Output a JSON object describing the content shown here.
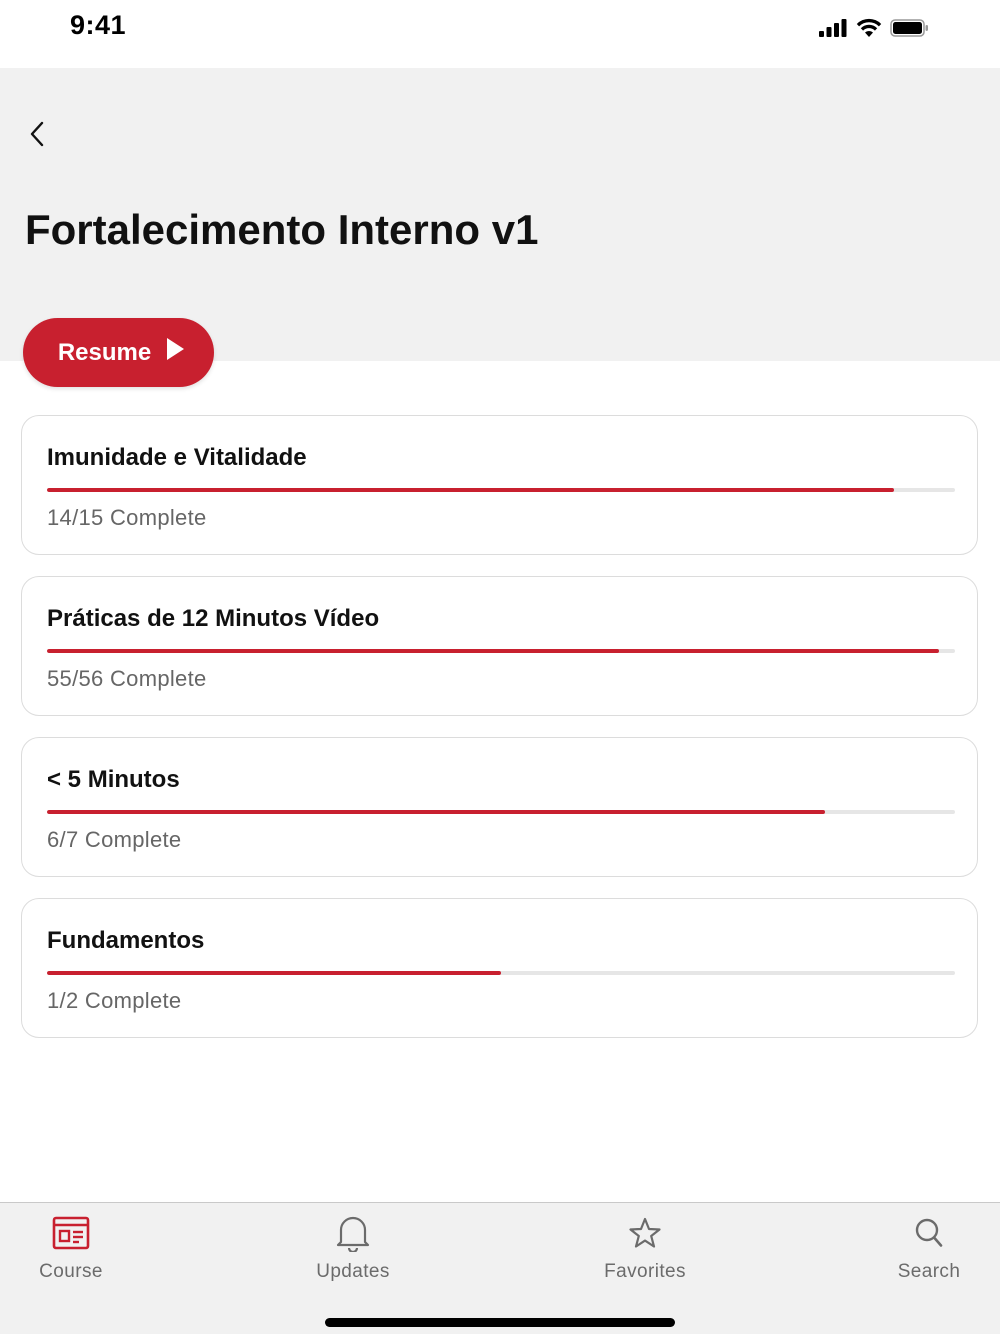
{
  "status_bar": {
    "time": "9:41"
  },
  "header": {
    "title": "Fortalecimento Interno v1",
    "back_icon": "chevron-left-icon"
  },
  "resume_button": {
    "label": "Resume",
    "icon": "play-icon",
    "color": "#c8202f"
  },
  "modules": [
    {
      "title": "Imunidade e Vitalidade",
      "status": "14/15 Complete",
      "progress": 0.933
    },
    {
      "title": "Práticas de 12 Minutos Vídeo",
      "status": "55/56 Complete",
      "progress": 0.982
    },
    {
      "title": "< 5 Minutos",
      "status": "6/7 Complete",
      "progress": 0.857
    },
    {
      "title": "Fundamentos",
      "status": "1/2 Complete",
      "progress": 0.5
    }
  ],
  "tabs": [
    {
      "label": "Course",
      "icon": "course-icon",
      "active": true
    },
    {
      "label": "Updates",
      "icon": "bell-icon",
      "active": false
    },
    {
      "label": "Favorites",
      "icon": "star-icon",
      "active": false
    },
    {
      "label": "Search",
      "icon": "search-icon",
      "active": false
    }
  ],
  "colors": {
    "accent": "#c8202f",
    "header_bg": "#f1f1f1",
    "muted_text": "#666666"
  }
}
